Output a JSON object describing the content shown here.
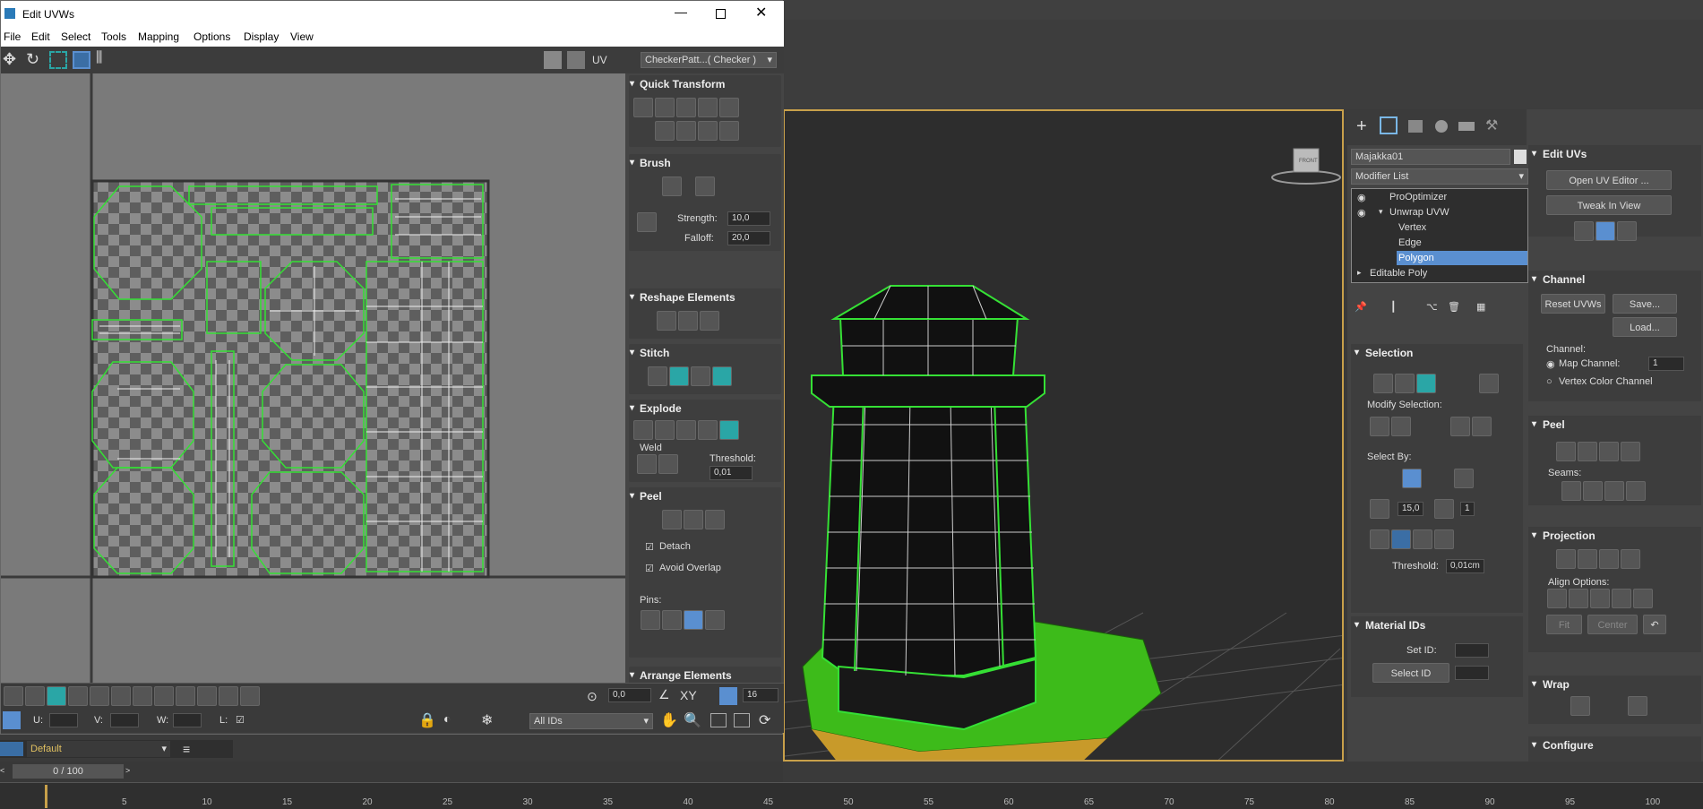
{
  "uvw_window": {
    "title": "Edit UVWs",
    "menu": [
      "File",
      "Edit",
      "Select",
      "Tools",
      "Mapping",
      "Options",
      "Display",
      "View"
    ],
    "uv_label": "UV",
    "texture_dropdown": "CheckerPatt...( Checker )",
    "rollouts": {
      "quick_transform": "Quick Transform",
      "brush": "Brush",
      "strength_label": "Strength:",
      "strength_value": "10,0",
      "falloff_label": "Falloff:",
      "falloff_value": "20,0",
      "reshape": "Reshape Elements",
      "stitch": "Stitch",
      "explode": "Explode",
      "weld": "Weld",
      "threshold_label": "Threshold:",
      "threshold_value": "0,01",
      "peel": "Peel",
      "detach": "Detach",
      "avoid_overlap": "Avoid Overlap",
      "pins": "Pins:",
      "arrange": "Arrange Elements"
    },
    "bottom": {
      "spin_value": "0,0",
      "xy_label": "XY",
      "grid_value": "16",
      "u_label": "U:",
      "v_label": "V:",
      "w_label": "W:",
      "l_label": "L:",
      "ids_dropdown": "All IDs"
    }
  },
  "scene": {
    "layer": "Default",
    "frame_counter": "0 / 100",
    "ticks": [
      "5",
      "10",
      "15",
      "20",
      "25",
      "30",
      "35",
      "40",
      "45",
      "50",
      "55",
      "60",
      "65",
      "70",
      "75",
      "80",
      "85",
      "90",
      "95",
      "100"
    ]
  },
  "command_panel": {
    "object_name": "Majakka01",
    "modifier_list": "Modifier List",
    "stack": [
      "ProOptimizer",
      "Unwrap UVW",
      "Vertex",
      "Edge",
      "Polygon",
      "Editable Poly"
    ],
    "selection_title": "Selection",
    "modify_selection": "Modify Selection:",
    "select_by": "Select By:",
    "angle_value": "15,0",
    "count_value": "1",
    "threshold_label": "Threshold:",
    "threshold_value": "0,01cm",
    "material_ids": "Material IDs",
    "set_id": "Set ID:",
    "select_id": "Select ID",
    "edit_uvs": "Edit UVs",
    "open_uv_editor": "Open UV Editor ...",
    "tweak_in_view": "Tweak In View",
    "channel": "Channel",
    "reset_uvws": "Reset UVWs",
    "save": "Save...",
    "load": "Load...",
    "channel_label": "Channel:",
    "map_channel": "Map Channel:",
    "map_channel_value": "1",
    "vertex_color_channel": "Vertex Color Channel",
    "peel": "Peel",
    "seams": "Seams:",
    "projection": "Projection",
    "align_options": "Align Options:",
    "fit": "Fit",
    "center": "Center",
    "wrap": "Wrap",
    "configure": "Configure"
  },
  "viewcube": {
    "label": "FRONT"
  },
  "colors": {
    "accent": "#5a8fd0",
    "selection_green": "#35e035",
    "teal": "#2aa6a6",
    "viewport_border": "#c8a04a"
  }
}
